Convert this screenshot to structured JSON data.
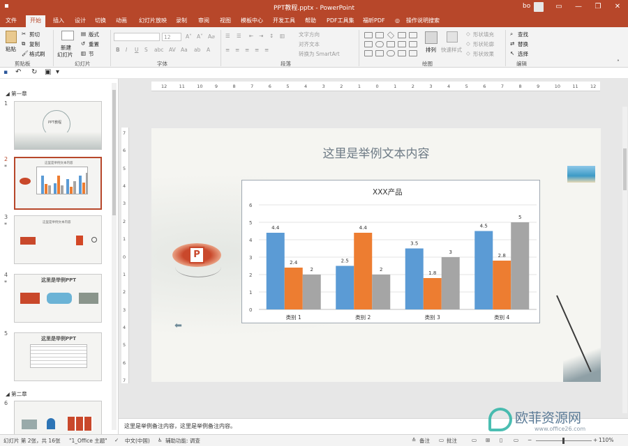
{
  "window": {
    "title": "PPT教程.pptx  -  PowerPoint",
    "user": "bo",
    "minimize": "—",
    "restore": "❐",
    "close": "✕",
    "ribbon_toggle": "▭"
  },
  "tabs": [
    "文件",
    "开始",
    "插入",
    "设计",
    "切换",
    "动画",
    "幻灯片放映",
    "录制",
    "审阅",
    "视图",
    "模板中心",
    "开发工具",
    "帮助",
    "PDF工具集",
    "福昕PDF"
  ],
  "tell_me": "操作说明搜索",
  "ribbon": {
    "clipboard": {
      "label": "剪贴板",
      "paste": "粘贴",
      "cut": "剪切",
      "copy": "复制",
      "format_painter": "格式刷"
    },
    "slides": {
      "label": "幻灯片",
      "new_slide": "新建",
      "new_slide2": "幻灯片",
      "layout": "版式",
      "reset": "重置",
      "section": "节"
    },
    "font": {
      "label": "字体",
      "size": "12"
    },
    "paragraph": {
      "label": "段落",
      "text_direction": "文字方向",
      "align_text": "对齐文本",
      "smartart": "转换为 SmartArt"
    },
    "drawing": {
      "label": "绘图",
      "arrange": "排列",
      "quick_styles": "快速样式",
      "shape_fill": "形状填充",
      "shape_outline": "形状轮廓",
      "shape_effects": "形状效果"
    },
    "editing": {
      "label": "编辑",
      "find": "查找",
      "replace": "替换",
      "select": "选择"
    }
  },
  "sections": {
    "first": "第一章",
    "second": "第二章"
  },
  "thumbnails": [
    {
      "num": "1",
      "title": "PPT教程"
    },
    {
      "num": "2",
      "title": "这里是举例文本内容"
    },
    {
      "num": "3",
      "title": "这里是举例文本内容"
    },
    {
      "num": "4",
      "title": "这里是举例PPT"
    },
    {
      "num": "5",
      "title": "这里是举例PPT"
    },
    {
      "num": "6",
      "title": ""
    }
  ],
  "ruler_h": [
    "12",
    "11",
    "10",
    "9",
    "8",
    "7",
    "6",
    "5",
    "4",
    "3",
    "2",
    "1",
    "0",
    "1",
    "2",
    "3",
    "4",
    "5",
    "6",
    "7",
    "8",
    "9",
    "10",
    "11",
    "12"
  ],
  "ruler_v": [
    "7",
    "6",
    "5",
    "4",
    "3",
    "2",
    "1",
    "0",
    "1",
    "2",
    "3",
    "4",
    "5",
    "6",
    "7"
  ],
  "slide": {
    "title": "这里是举例文本内容"
  },
  "chart_data": {
    "type": "bar",
    "title": "XXX产品",
    "categories": [
      "类别 1",
      "类别 2",
      "类别 3",
      "类别 4"
    ],
    "series": [
      {
        "values": [
          4.4,
          2.5,
          3.5,
          4.5
        ],
        "color": "#5b9bd5"
      },
      {
        "values": [
          2.4,
          4.4,
          1.8,
          2.8
        ],
        "color": "#ed7d31"
      },
      {
        "values": [
          2,
          2,
          3,
          5
        ],
        "color": "#a5a5a5"
      }
    ],
    "ylim": [
      0,
      6
    ],
    "yticks": [
      "0",
      "1",
      "2",
      "3",
      "4",
      "5",
      "6"
    ],
    "grid": true,
    "data_labels": true
  },
  "notes": "这里是举例备注内容，这里是举例备注内容。",
  "status": {
    "slide_info": "幻灯片 第 2张，共 16张",
    "theme": "\"1_Office 主题\"",
    "language": "中文(中国)",
    "accessibility": "辅助功能: 调查",
    "notes_btn": "备注",
    "comments_btn": "批注",
    "zoom": "110%"
  },
  "watermark": {
    "text": "欧菲资源网",
    "url": "www.office26.com"
  },
  "colors": {
    "accent": "#b7472a",
    "series1": "#5b9bd5",
    "series2": "#ed7d31",
    "series3": "#a5a5a5"
  }
}
